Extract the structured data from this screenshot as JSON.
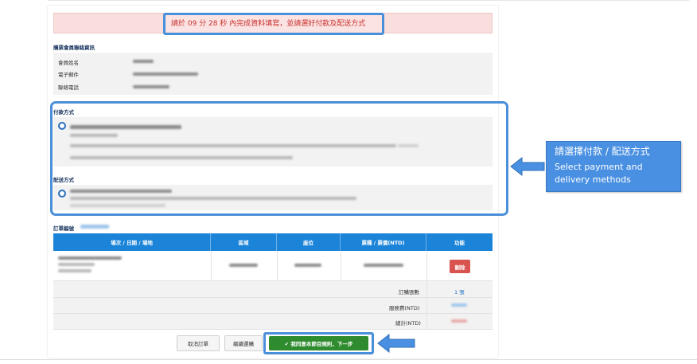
{
  "alert": {
    "text": "請於 09 分 28 秒 內完成資料填寫，並請選好付款及配送方式"
  },
  "member_info": {
    "title": "購票會員聯絡資訊",
    "fields": [
      {
        "label": "會員姓名"
      },
      {
        "label": "電子郵件"
      },
      {
        "label": "聯絡電話"
      }
    ]
  },
  "payment": {
    "title": "付款方式"
  },
  "delivery": {
    "title": "配送方式"
  },
  "order": {
    "number_label": "訂單編號",
    "columns": [
      "場次 / 日期 / 場地",
      "區域",
      "座位",
      "票種 / 票價(NTD)",
      "功能"
    ],
    "delete_label": "刪除",
    "summary": {
      "count_label": "訂購張數",
      "count_value": "1 張",
      "fee_label": "服務費(NTD)",
      "total_label": "總計(NTD)"
    }
  },
  "buttons": {
    "cancel": "取消訂單",
    "continue": "繼續選購",
    "next": "✔ 我同意本節目規則，下一步"
  },
  "callout": {
    "zh": "請選擇付款 / 配送方式",
    "en": "Select payment and delivery methods"
  },
  "colors": {
    "accent": "#4a8fd9",
    "table_header": "#1b84d9",
    "alert_text": "#c9302c",
    "next_button": "#2e8b2e",
    "delete_button": "#d9534f"
  }
}
